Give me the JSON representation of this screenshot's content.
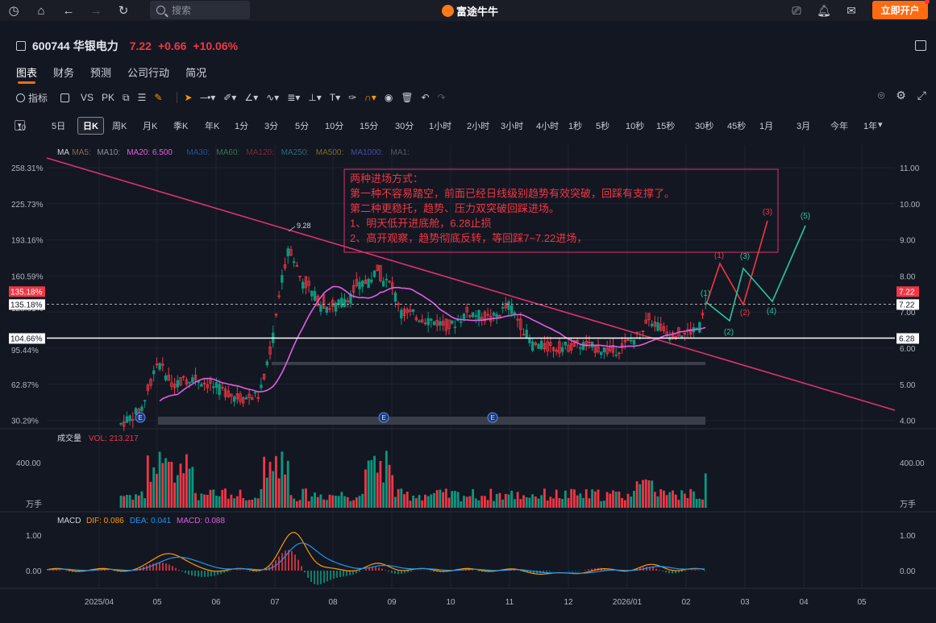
{
  "topbar": {
    "icons": [
      "history-icon",
      "home-icon",
      "back-icon",
      "forward-icon",
      "refresh-icon"
    ],
    "search_placeholder": "搜索",
    "brand": "富途牛牛",
    "right_icons": [
      "screen-icon",
      "bell-icon",
      "mail-icon"
    ],
    "open_account": "立即开户"
  },
  "stock": {
    "code": "600744",
    "name": "华银电力",
    "price": "7.22",
    "change": "+0.66",
    "change_pct": "+10.06%",
    "up_color": "#f23645"
  },
  "tabs": [
    {
      "label": "图表",
      "active": true
    },
    {
      "label": "财务"
    },
    {
      "label": "预测"
    },
    {
      "label": "公司行动"
    },
    {
      "label": "简况"
    }
  ],
  "toolbar": {
    "indicator_label": "指标",
    "vs_label": "VS",
    "pk_label": "PK"
  },
  "periods": {
    "selector_label": "10",
    "items": [
      "5日",
      "日K",
      "周K",
      "月K",
      "季K",
      "年K",
      "1分",
      "3分",
      "5分",
      "10分",
      "15分",
      "30分",
      "1小时",
      "2小时",
      "3小时",
      "4小时",
      "1秒",
      "5秒",
      "10秒",
      "15秒",
      "30秒",
      "45秒",
      "1月",
      "3月",
      "今年",
      "1年"
    ],
    "active": "日K"
  },
  "ma_legend": [
    {
      "label": "MA",
      "color": "#d1d4dc"
    },
    {
      "label": "MA5:",
      "color": "#8a6a4a"
    },
    {
      "label": "MA10:",
      "color": "#8a8f99"
    },
    {
      "label": "MA20: 6.500",
      "color": "#e05fe0"
    },
    {
      "label": "MA30:",
      "color": "#2a4f8f"
    },
    {
      "label": "MA60:",
      "color": "#2f7a4a"
    },
    {
      "label": "MA120:",
      "color": "#7a2a3a"
    },
    {
      "label": "MA250:",
      "color": "#2a6a7a"
    },
    {
      "label": "MA500:",
      "color": "#7a6a2a"
    },
    {
      "label": "MA1000:",
      "color": "#4a4aaa"
    },
    {
      "label": "MA1:",
      "color": "#555a66"
    }
  ],
  "price_axis_right": [
    "11.00",
    "10.00",
    "9.00",
    "8.00",
    "7.00",
    "6.00",
    "5.00",
    "4.00"
  ],
  "pct_axis_left": [
    "258.31%",
    "225.73%",
    "193.16%",
    "160.59%",
    "128.01%",
    "95.44%",
    "62.87%",
    "30.29%"
  ],
  "price_markers": {
    "current": {
      "price": "7.22",
      "pct": "135.18%",
      "pct2": "135.18%"
    },
    "stop": {
      "price": "6.28",
      "pct": "104.66%"
    }
  },
  "high_label": "9.28",
  "events": [
    "E",
    "E",
    "E"
  ],
  "annotation": {
    "lines": [
      "两种进场方式：",
      "第一种不容易踏空，前面已经日线级别趋势有效突破，回踩有支撑了。",
      "第二种更稳托，趋势、压力双突破回踩进场。",
      "1、明天低开进底舱，6.28止损",
      "2、高开观察，趋势彻底反转，等回踩7~7.22进场，"
    ],
    "color": "#f23645"
  },
  "wave_labels": {
    "red": [
      "(1)",
      "(2)",
      "(3)"
    ],
    "green": [
      "(1)",
      "(2)",
      "(3)",
      "(4)",
      "(5)"
    ]
  },
  "volume": {
    "title": "成交量",
    "vol_label": "VOL: 213.217",
    "axis_label": "400.00",
    "unit": "万手"
  },
  "macd": {
    "title": "MACD",
    "dif": "DIF: 0.086",
    "dea": "DEA: 0.041",
    "macd": "MACD: 0.088",
    "axis": [
      "1.00",
      "0.00"
    ]
  },
  "time_axis": [
    "2025/04",
    "05",
    "06",
    "07",
    "08",
    "09",
    "10",
    "11",
    "12",
    "2026/01",
    "02",
    "03",
    "04",
    "05"
  ],
  "colors": {
    "up": "#f23645",
    "down": "#089981",
    "ma20": "#e05fe0",
    "trendline": "#e0326e",
    "dif": "#ff9800",
    "dea": "#2196f3"
  },
  "chart_data": {
    "type": "candlestick",
    "title": "600744 华银电力",
    "price_range": [
      4.0,
      11.0
    ],
    "last_close": 7.22,
    "stop_loss": 6.28,
    "high": 9.28,
    "monthly_closes": {
      "05": 5.2,
      "06": 4.9,
      "07": 8.2,
      "08": 7.3,
      "09": 7.8,
      "10": 6.6,
      "11": 6.8,
      "12": 6.1,
      "01": 6.4,
      "02": 7.22
    },
    "ma20_last": 6.5,
    "volume_last": 213.217,
    "macd": {
      "dif": 0.086,
      "dea": 0.041,
      "macd": 0.088
    }
  }
}
